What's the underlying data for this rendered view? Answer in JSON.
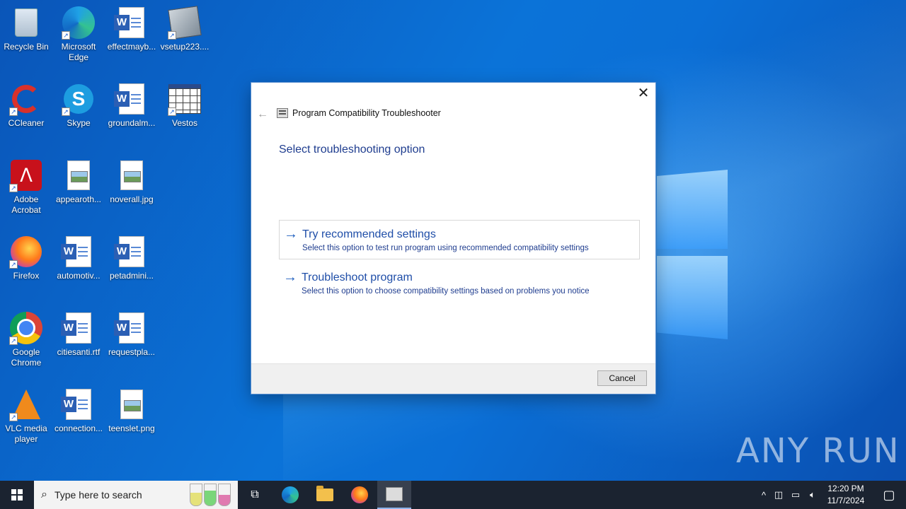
{
  "desktop": {
    "icons": [
      {
        "label": "Recycle Bin",
        "icon": "recycle-bin-icon"
      },
      {
        "label": "Microsoft Edge",
        "icon": "edge-icon"
      },
      {
        "label": "effectmayb...",
        "icon": "word-document-icon"
      },
      {
        "label": "vsetup223....",
        "icon": "installer-icon"
      },
      {
        "label": "CCleaner",
        "icon": "ccleaner-icon"
      },
      {
        "label": "Skype",
        "icon": "skype-icon"
      },
      {
        "label": "groundalm...",
        "icon": "word-document-icon"
      },
      {
        "label": "Vestos",
        "icon": "calendar-app-icon"
      },
      {
        "label": "Adobe Acrobat",
        "icon": "acrobat-icon"
      },
      {
        "label": "appearoth...",
        "icon": "image-file-icon"
      },
      {
        "label": "noverall.jpg",
        "icon": "image-file-icon"
      },
      {
        "label": "Firefox",
        "icon": "firefox-icon"
      },
      {
        "label": "automotiv...",
        "icon": "word-document-icon"
      },
      {
        "label": "petadmini...",
        "icon": "word-document-icon"
      },
      {
        "label": "Google Chrome",
        "icon": "chrome-icon"
      },
      {
        "label": "citiesanti.rtf",
        "icon": "word-document-icon"
      },
      {
        "label": "requestpla...",
        "icon": "word-document-icon"
      },
      {
        "label": "VLC media player",
        "icon": "vlc-icon"
      },
      {
        "label": "connection...",
        "icon": "word-document-icon"
      },
      {
        "label": "teenslet.png",
        "icon": "image-file-icon"
      }
    ]
  },
  "dialog": {
    "window_title": "Program Compatibility Troubleshooter",
    "heading": "Select troubleshooting option",
    "options": [
      {
        "title": "Try recommended settings",
        "description": "Select this option to test run program using recommended compatibility settings"
      },
      {
        "title": "Troubleshoot program",
        "description": "Select this option to choose compatibility settings based on problems you notice"
      }
    ],
    "cancel_label": "Cancel"
  },
  "watermark": "ANY RUN",
  "taskbar": {
    "search_placeholder": "Type here to search",
    "time": "12:20 PM",
    "date": "11/7/2024"
  },
  "colors": {
    "accent": "#1f5fbf",
    "heading": "#1f3d8f",
    "taskbar": "#1b2330"
  }
}
